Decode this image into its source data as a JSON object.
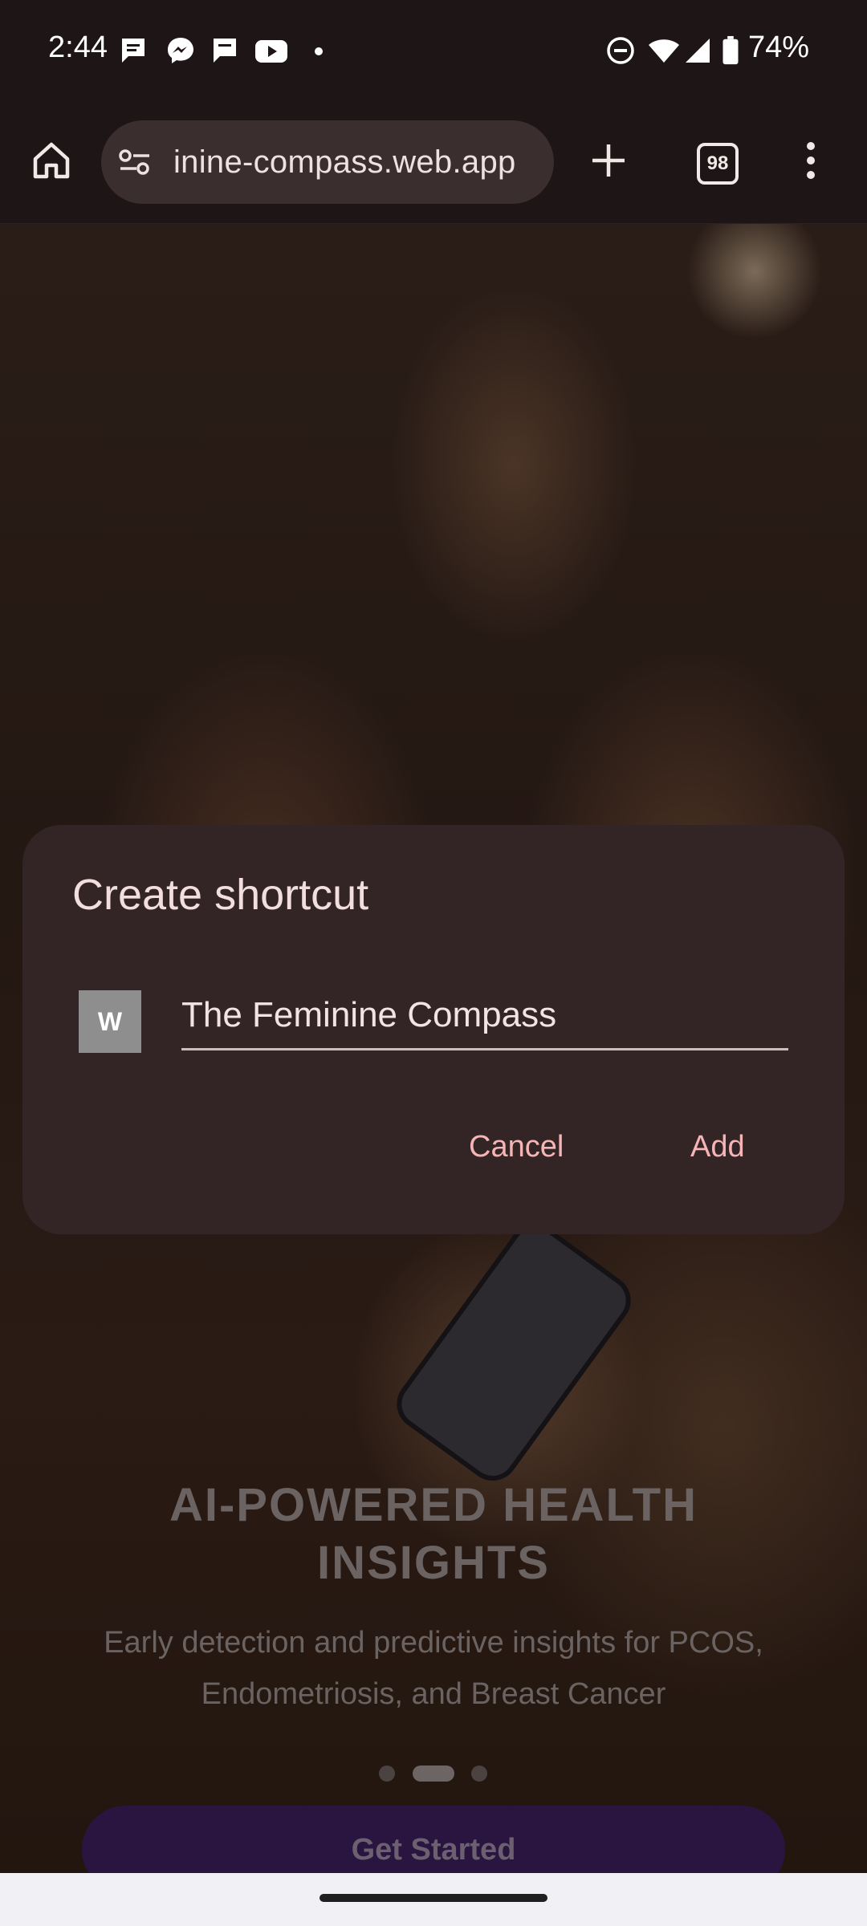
{
  "status_bar": {
    "time": "2:44",
    "battery_text": "74%",
    "left_icons": [
      "chat-icon",
      "messenger-icon",
      "chat-icon",
      "youtube-icon",
      "dot-icon"
    ],
    "right_icons": [
      "dnd-icon",
      "wifi-icon",
      "signal-icon",
      "battery-icon"
    ]
  },
  "browser": {
    "url": "inine-compass.web.app",
    "tab_count": "98",
    "icons": [
      "home-icon",
      "site-settings-icon",
      "new-tab-icon",
      "tab-switcher-icon",
      "more-icon"
    ]
  },
  "page": {
    "hero_title_line1": "AI-POWERED HEALTH",
    "hero_title_line2": "INSIGHTS",
    "hero_subtitle_line1": "Early detection and predictive insights for PCOS,",
    "hero_subtitle_line2": "Endometriosis, and Breast Cancer",
    "carousel_active_index": 1,
    "carousel_count": 3,
    "cta_label": "Get Started"
  },
  "dialog": {
    "title": "Create shortcut",
    "icon_letter": "W",
    "shortcut_name": "The Feminine Compass",
    "cancel_label": "Cancel",
    "add_label": "Add"
  },
  "colors": {
    "dialog_bg": "#332526",
    "accent_text": "#f5b5b7",
    "cta_bg": "#2a1540"
  }
}
